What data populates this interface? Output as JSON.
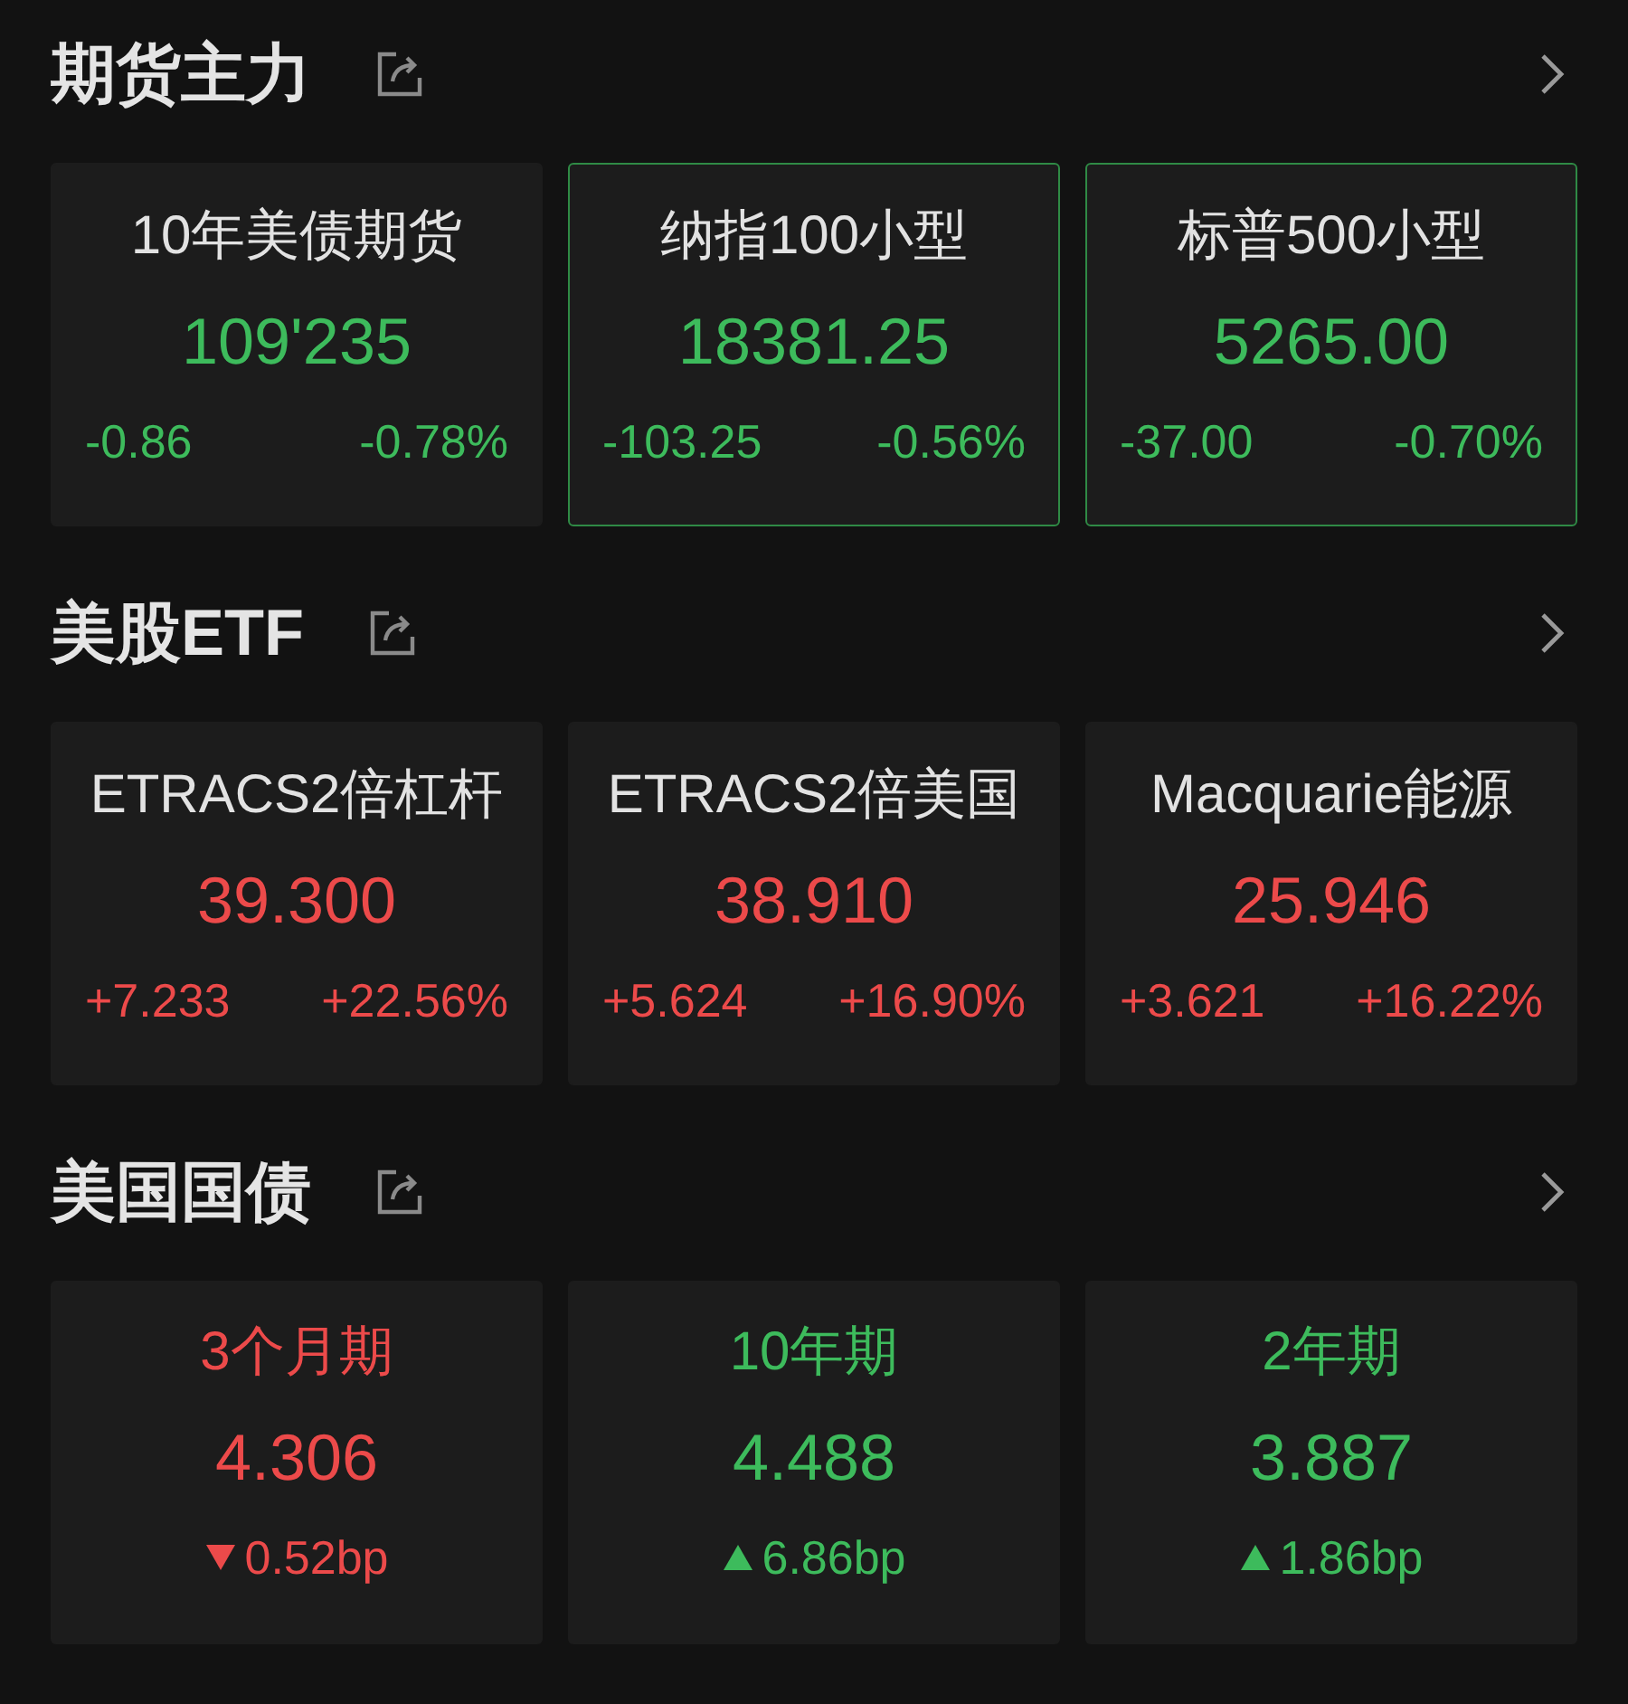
{
  "sections": [
    {
      "title": "期货主力",
      "kind": "quote",
      "cards": [
        {
          "name": "10年美债期货",
          "price": "109'235",
          "change": "-0.86",
          "percent": "-0.78%",
          "color": "#3dbb5c",
          "selected": false
        },
        {
          "name": "纳指100小型",
          "price": "18381.25",
          "change": "-103.25",
          "percent": "-0.56%",
          "color": "#3dbb5c",
          "selected": true
        },
        {
          "name": "标普500小型",
          "price": "5265.00",
          "change": "-37.00",
          "percent": "-0.70%",
          "color": "#3dbb5c",
          "selected": true
        }
      ]
    },
    {
      "title": "美股ETF",
      "kind": "quote",
      "cards": [
        {
          "name": "ETRACS2倍杠杆",
          "price": "39.300",
          "change": "+7.233",
          "percent": "+22.56%",
          "color": "#ec4a4a",
          "selected": false
        },
        {
          "name": "ETRACS2倍美国",
          "price": "38.910",
          "change": "+5.624",
          "percent": "+16.90%",
          "color": "#ec4a4a",
          "selected": false
        },
        {
          "name": "Macquarie能源",
          "price": "25.946",
          "change": "+3.621",
          "percent": "+16.22%",
          "color": "#ec4a4a",
          "selected": false
        }
      ]
    },
    {
      "title": "美国国债",
      "kind": "bond",
      "cards": [
        {
          "name": "3个月期",
          "price": "4.306",
          "change": "0.52bp",
          "rising": false,
          "color": "#ec4a4a"
        },
        {
          "name": "10年期",
          "price": "4.488",
          "change": "6.86bp",
          "rising": true,
          "color": "#3dbb5c"
        },
        {
          "name": "2年期",
          "price": "3.887",
          "change": "1.86bp",
          "rising": true,
          "color": "#3dbb5c"
        }
      ]
    }
  ]
}
